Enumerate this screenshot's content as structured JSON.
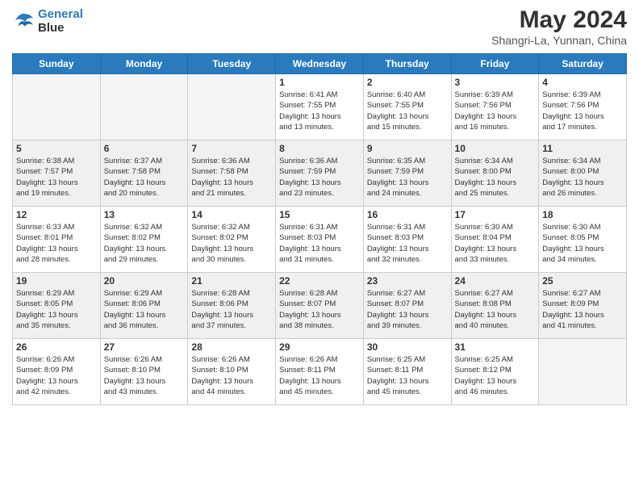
{
  "header": {
    "logo_line1": "General",
    "logo_line2": "Blue",
    "month_year": "May 2024",
    "location": "Shangri-La, Yunnan, China"
  },
  "weekdays": [
    "Sunday",
    "Monday",
    "Tuesday",
    "Wednesday",
    "Thursday",
    "Friday",
    "Saturday"
  ],
  "weeks": [
    [
      {
        "day": "",
        "info": ""
      },
      {
        "day": "",
        "info": ""
      },
      {
        "day": "",
        "info": ""
      },
      {
        "day": "1",
        "info": "Sunrise: 6:41 AM\nSunset: 7:55 PM\nDaylight: 13 hours\nand 13 minutes."
      },
      {
        "day": "2",
        "info": "Sunrise: 6:40 AM\nSunset: 7:55 PM\nDaylight: 13 hours\nand 15 minutes."
      },
      {
        "day": "3",
        "info": "Sunrise: 6:39 AM\nSunset: 7:56 PM\nDaylight: 13 hours\nand 16 minutes."
      },
      {
        "day": "4",
        "info": "Sunrise: 6:39 AM\nSunset: 7:56 PM\nDaylight: 13 hours\nand 17 minutes."
      }
    ],
    [
      {
        "day": "5",
        "info": "Sunrise: 6:38 AM\nSunset: 7:57 PM\nDaylight: 13 hours\nand 19 minutes."
      },
      {
        "day": "6",
        "info": "Sunrise: 6:37 AM\nSunset: 7:58 PM\nDaylight: 13 hours\nand 20 minutes."
      },
      {
        "day": "7",
        "info": "Sunrise: 6:36 AM\nSunset: 7:58 PM\nDaylight: 13 hours\nand 21 minutes."
      },
      {
        "day": "8",
        "info": "Sunrise: 6:36 AM\nSunset: 7:59 PM\nDaylight: 13 hours\nand 23 minutes."
      },
      {
        "day": "9",
        "info": "Sunrise: 6:35 AM\nSunset: 7:59 PM\nDaylight: 13 hours\nand 24 minutes."
      },
      {
        "day": "10",
        "info": "Sunrise: 6:34 AM\nSunset: 8:00 PM\nDaylight: 13 hours\nand 25 minutes."
      },
      {
        "day": "11",
        "info": "Sunrise: 6:34 AM\nSunset: 8:00 PM\nDaylight: 13 hours\nand 26 minutes."
      }
    ],
    [
      {
        "day": "12",
        "info": "Sunrise: 6:33 AM\nSunset: 8:01 PM\nDaylight: 13 hours\nand 28 minutes."
      },
      {
        "day": "13",
        "info": "Sunrise: 6:32 AM\nSunset: 8:02 PM\nDaylight: 13 hours\nand 29 minutes."
      },
      {
        "day": "14",
        "info": "Sunrise: 6:32 AM\nSunset: 8:02 PM\nDaylight: 13 hours\nand 30 minutes."
      },
      {
        "day": "15",
        "info": "Sunrise: 6:31 AM\nSunset: 8:03 PM\nDaylight: 13 hours\nand 31 minutes."
      },
      {
        "day": "16",
        "info": "Sunrise: 6:31 AM\nSunset: 8:03 PM\nDaylight: 13 hours\nand 32 minutes."
      },
      {
        "day": "17",
        "info": "Sunrise: 6:30 AM\nSunset: 8:04 PM\nDaylight: 13 hours\nand 33 minutes."
      },
      {
        "day": "18",
        "info": "Sunrise: 6:30 AM\nSunset: 8:05 PM\nDaylight: 13 hours\nand 34 minutes."
      }
    ],
    [
      {
        "day": "19",
        "info": "Sunrise: 6:29 AM\nSunset: 8:05 PM\nDaylight: 13 hours\nand 35 minutes."
      },
      {
        "day": "20",
        "info": "Sunrise: 6:29 AM\nSunset: 8:06 PM\nDaylight: 13 hours\nand 36 minutes."
      },
      {
        "day": "21",
        "info": "Sunrise: 6:28 AM\nSunset: 8:06 PM\nDaylight: 13 hours\nand 37 minutes."
      },
      {
        "day": "22",
        "info": "Sunrise: 6:28 AM\nSunset: 8:07 PM\nDaylight: 13 hours\nand 38 minutes."
      },
      {
        "day": "23",
        "info": "Sunrise: 6:27 AM\nSunset: 8:07 PM\nDaylight: 13 hours\nand 39 minutes."
      },
      {
        "day": "24",
        "info": "Sunrise: 6:27 AM\nSunset: 8:08 PM\nDaylight: 13 hours\nand 40 minutes."
      },
      {
        "day": "25",
        "info": "Sunrise: 6:27 AM\nSunset: 8:09 PM\nDaylight: 13 hours\nand 41 minutes."
      }
    ],
    [
      {
        "day": "26",
        "info": "Sunrise: 6:26 AM\nSunset: 8:09 PM\nDaylight: 13 hours\nand 42 minutes."
      },
      {
        "day": "27",
        "info": "Sunrise: 6:26 AM\nSunset: 8:10 PM\nDaylight: 13 hours\nand 43 minutes."
      },
      {
        "day": "28",
        "info": "Sunrise: 6:26 AM\nSunset: 8:10 PM\nDaylight: 13 hours\nand 44 minutes."
      },
      {
        "day": "29",
        "info": "Sunrise: 6:26 AM\nSunset: 8:11 PM\nDaylight: 13 hours\nand 45 minutes."
      },
      {
        "day": "30",
        "info": "Sunrise: 6:25 AM\nSunset: 8:11 PM\nDaylight: 13 hours\nand 45 minutes."
      },
      {
        "day": "31",
        "info": "Sunrise: 6:25 AM\nSunset: 8:12 PM\nDaylight: 13 hours\nand 46 minutes."
      },
      {
        "day": "",
        "info": ""
      }
    ]
  ]
}
